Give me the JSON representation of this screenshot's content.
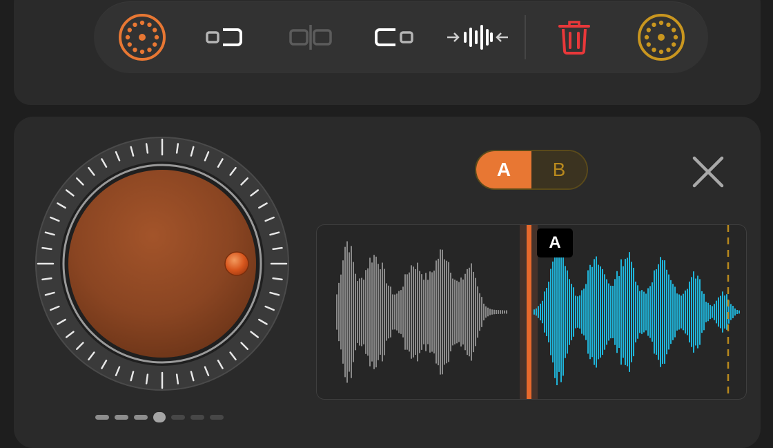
{
  "colors": {
    "accent_orange": "#e87733",
    "delete_red": "#e8383a",
    "gold": "#c9961f",
    "cyan_wave": "#1fb4d9",
    "gray_wave": "#8a8a8a"
  },
  "toolbar": {
    "items": [
      {
        "icon": "orange-dotted-dial-icon"
      },
      {
        "icon": "trim-left-icon"
      },
      {
        "icon": "split-icon"
      },
      {
        "icon": "trim-right-icon"
      },
      {
        "icon": "compress-wave-icon"
      },
      {
        "icon": "trash-icon"
      },
      {
        "icon": "gold-dotted-dial-icon"
      }
    ]
  },
  "ab_toggle": {
    "a_label": "A",
    "b_label": "B",
    "selected": "A"
  },
  "marker": {
    "label": "A"
  },
  "pager": {
    "count": 7,
    "active_index": 3
  }
}
